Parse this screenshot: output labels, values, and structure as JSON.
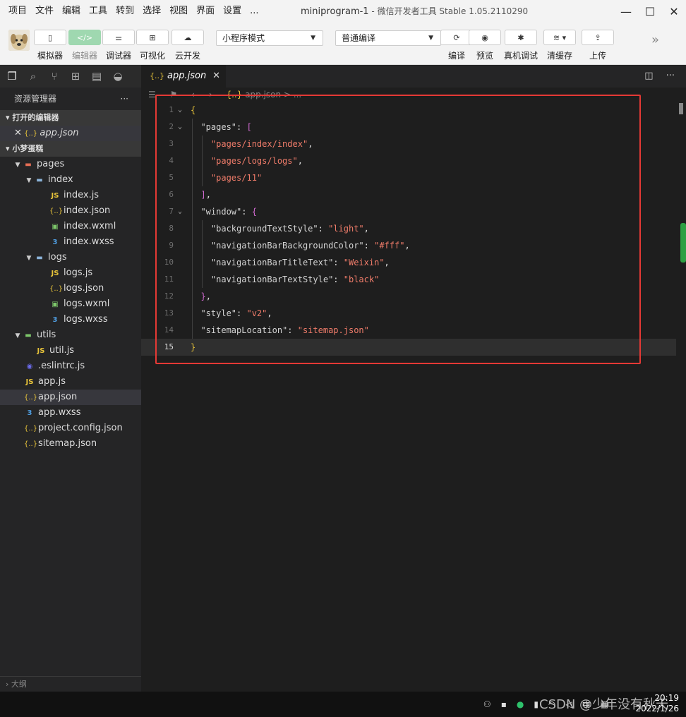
{
  "menu": [
    "项目",
    "文件",
    "编辑",
    "工具",
    "转到",
    "选择",
    "视图",
    "界面",
    "设置",
    "..."
  ],
  "window_title": "miniprogram-1",
  "window_subtitle": "- 微信开发者工具 Stable 1.05.2110290",
  "toolbar": {
    "simulator": "模拟器",
    "editor": "编辑器",
    "debugger": "调试器",
    "visual": "可视化",
    "cloud": "云开发",
    "mode_select": "小程序模式",
    "compile_select": "普通编译",
    "compile": "编译",
    "preview": "预览",
    "real_debug": "真机调试",
    "clear_cache": "清缓存",
    "upload": "上传"
  },
  "sidebar": {
    "title": "资源管理器",
    "open_editors": "打开的编辑器",
    "open_file": "app.json",
    "project": "小梦蛋糕",
    "tree": [
      {
        "name": "pages",
        "type": "folder-pages",
        "level": 1,
        "expanded": true
      },
      {
        "name": "index",
        "type": "folder",
        "level": 2,
        "expanded": true
      },
      {
        "name": "index.js",
        "type": "js",
        "level": 3
      },
      {
        "name": "index.json",
        "type": "json",
        "level": 3
      },
      {
        "name": "index.wxml",
        "type": "wxml",
        "level": 3
      },
      {
        "name": "index.wxss",
        "type": "wxss",
        "level": 3
      },
      {
        "name": "logs",
        "type": "folder",
        "level": 2,
        "expanded": true
      },
      {
        "name": "logs.js",
        "type": "js",
        "level": 3
      },
      {
        "name": "logs.json",
        "type": "json",
        "level": 3
      },
      {
        "name": "logs.wxml",
        "type": "wxml",
        "level": 3
      },
      {
        "name": "logs.wxss",
        "type": "wxss",
        "level": 3
      },
      {
        "name": "utils",
        "type": "folder-utils",
        "level": 1,
        "expanded": true
      },
      {
        "name": "util.js",
        "type": "js",
        "level": 2
      },
      {
        "name": ".eslintrc.js",
        "type": "eslint",
        "level": 1
      },
      {
        "name": "app.js",
        "type": "js",
        "level": 1
      },
      {
        "name": "app.json",
        "type": "json",
        "level": 1,
        "selected": true
      },
      {
        "name": "app.wxss",
        "type": "wxss",
        "level": 1
      },
      {
        "name": "project.config.json",
        "type": "json",
        "level": 1
      },
      {
        "name": "sitemap.json",
        "type": "json",
        "level": 1
      }
    ],
    "bottom": "大纲"
  },
  "tab": {
    "name": "app.json"
  },
  "breadcrumb": "app.json > ...",
  "code_lines": [
    {
      "n": "1",
      "fold": true,
      "html": "<span class='br'>{</span>"
    },
    {
      "n": "2",
      "fold": true,
      "html": "  <span class='k'>\"pages\"</span>: <span class='br2'>[</span>"
    },
    {
      "n": "3",
      "html": "    <span class='s'>\"pages/index/index\"</span>,"
    },
    {
      "n": "4",
      "html": "    <span class='s'>\"pages/logs/logs\"</span>,"
    },
    {
      "n": "5",
      "html": "    <span class='s'>\"pages/11\"</span>"
    },
    {
      "n": "6",
      "html": "  <span class='br2'>]</span>,"
    },
    {
      "n": "7",
      "fold": true,
      "html": "  <span class='k'>\"window\"</span>: <span class='br2'>{</span>"
    },
    {
      "n": "8",
      "html": "    <span class='k'>\"backgroundTextStyle\"</span>: <span class='s'>\"light\"</span>,"
    },
    {
      "n": "9",
      "html": "    <span class='k'>\"navigationBarBackgroundColor\"</span>: <span class='s'>\"#fff\"</span>,"
    },
    {
      "n": "10",
      "html": "    <span class='k'>\"navigationBarTitleText\"</span>: <span class='s'>\"Weixin\"</span>,"
    },
    {
      "n": "11",
      "html": "    <span class='k'>\"navigationBarTextStyle\"</span>: <span class='s'>\"black\"</span>"
    },
    {
      "n": "12",
      "html": "  <span class='br2'>}</span>,"
    },
    {
      "n": "13",
      "html": "  <span class='k'>\"style\"</span>: <span class='s'>\"v2\"</span>,"
    },
    {
      "n": "14",
      "html": "  <span class='k'>\"sitemapLocation\"</span>: <span class='s'>\"sitemap.json\"</span>"
    },
    {
      "n": "15",
      "current": true,
      "html": "<span class='br'>}</span>"
    }
  ],
  "taskbar": {
    "time": "20:19",
    "date": "2022/1/26"
  },
  "watermark": "CSDN @少年没有秋天"
}
